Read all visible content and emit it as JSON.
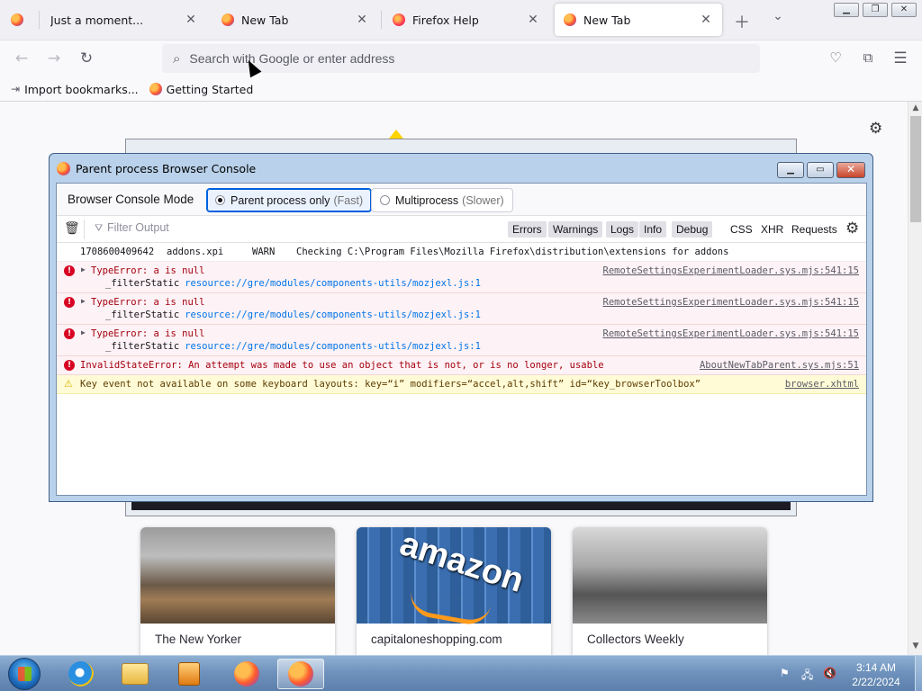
{
  "browser": {
    "tabs": [
      {
        "label": "Just a moment...",
        "favicon": "firefox-icon",
        "active": false
      },
      {
        "label": "New Tab",
        "favicon": "firefox-icon",
        "active": false
      },
      {
        "label": "Firefox Help",
        "favicon": "firefox-help-icon",
        "active": false
      },
      {
        "label": "New Tab",
        "favicon": "firefox-icon",
        "active": true
      }
    ],
    "new_tab_icon": "plus-icon",
    "list_tabs_icon": "chevron-down-icon",
    "address_placeholder": "Search with Google or enter address",
    "bookmarks": [
      {
        "label": "Import bookmarks...",
        "icon": "import-icon"
      },
      {
        "label": "Getting Started",
        "icon": "firefox-icon"
      }
    ]
  },
  "newtab": {
    "settings_icon": "gear-icon",
    "cards": [
      {
        "label": "The New Yorker"
      },
      {
        "label": "capitaloneshopping.com"
      },
      {
        "label": "Collectors Weekly"
      }
    ]
  },
  "console": {
    "title": "Parent process Browser Console",
    "mode_label": "Browser Console Mode",
    "modes": [
      {
        "label": "Parent process only",
        "hint": "(Fast)",
        "selected": true
      },
      {
        "label": "Multiprocess",
        "hint": "(Slower)",
        "selected": false
      }
    ],
    "filter_placeholder": "Filter Output",
    "filters": [
      "Errors",
      "Warnings",
      "Logs",
      "Info",
      "Debug"
    ],
    "net_filters": [
      "CSS",
      "XHR",
      "Requests"
    ],
    "messages": [
      {
        "level": "info",
        "timestamp": "1708600409642",
        "source_name": "addons.xpi",
        "kind": "WARN",
        "text": "Checking C:\\Program Files\\Mozilla Firefox\\distribution\\extensions for addons"
      },
      {
        "level": "error",
        "text": "TypeError: a is null",
        "frame": "_filterStatic",
        "resource": "resource://gre/modules/components-utils/mozjexl.js:1",
        "location": "RemoteSettingsExperimentLoader.sys.mjs:541:15"
      },
      {
        "level": "error",
        "text": "TypeError: a is null",
        "frame": "_filterStatic",
        "resource": "resource://gre/modules/components-utils/mozjexl.js:1",
        "location": "RemoteSettingsExperimentLoader.sys.mjs:541:15"
      },
      {
        "level": "error",
        "text": "TypeError: a is null",
        "frame": "_filterStatic",
        "resource": "resource://gre/modules/components-utils/mozjexl.js:1",
        "location": "RemoteSettingsExperimentLoader.sys.mjs:541:15"
      },
      {
        "level": "error",
        "text": "InvalidStateError: An attempt was made to use an object that is not, or is no longer, usable",
        "location": "AboutNewTabParent.sys.mjs:51"
      },
      {
        "level": "warning",
        "text": "Key event not available on some keyboard layouts: key=“i” modifiers=“accel,alt,shift” id=“key_browserToolbox”",
        "location": "browser.xhtml"
      }
    ]
  },
  "taskbar": {
    "clock_time": "3:14 AM",
    "clock_date": "2/22/2024"
  },
  "colors": {
    "accent": "#0060df",
    "error_text": "#a4000f",
    "error_bg": "#fdf2f5",
    "warning_bg": "#fffbd6"
  }
}
